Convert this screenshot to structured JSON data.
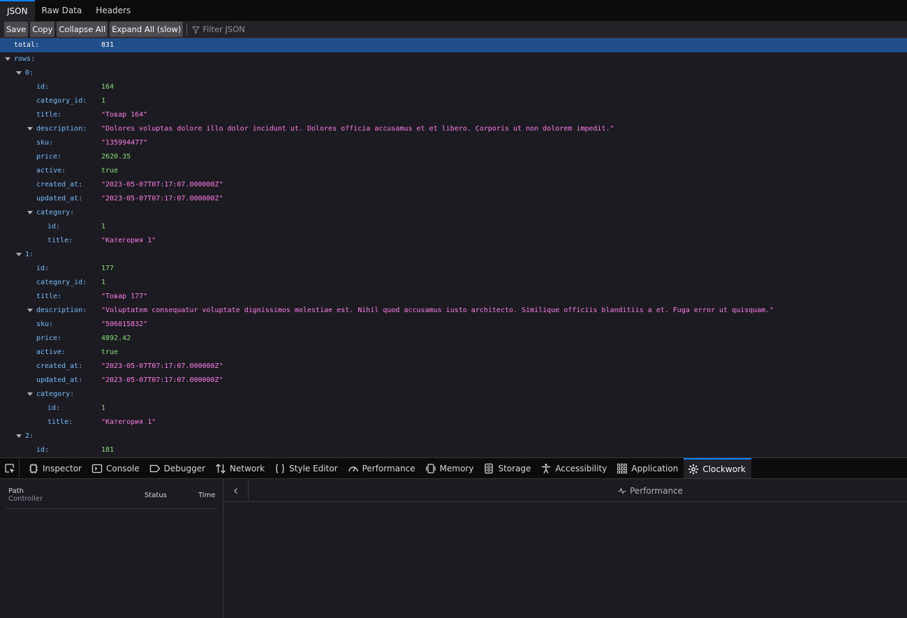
{
  "viewer_tabs": [
    "JSON",
    "Raw Data",
    "Headers"
  ],
  "toolbar": {
    "save_label": "Save",
    "copy_label": "Copy",
    "collapse_label": "Collapse All",
    "expand_label": "Expand All (slow)",
    "filter_placeholder": "Filter JSON"
  },
  "tree": [
    {
      "depth": 0,
      "key": "total:",
      "value": "831",
      "type": "num",
      "selected": true
    },
    {
      "depth": 0,
      "key": "rows:",
      "toggle": true
    },
    {
      "depth": 1,
      "key": "0:",
      "toggle": true
    },
    {
      "depth": 2,
      "key": "id:",
      "value": "164",
      "type": "num"
    },
    {
      "depth": 2,
      "key": "category_id:",
      "value": "1",
      "type": "num"
    },
    {
      "depth": 2,
      "key": "title:",
      "value": "\"Товар 164\"",
      "type": "str"
    },
    {
      "depth": 2,
      "key": "description:",
      "value": "\"Dolores voluptas dolore illo dolor incidunt ut. Dolores officia accusamus et et libero. Corporis ut non dolorem impedit.\"",
      "type": "str",
      "toggle": true
    },
    {
      "depth": 2,
      "key": "sku:",
      "value": "\"135994477\"",
      "type": "str"
    },
    {
      "depth": 2,
      "key": "price:",
      "value": "2620.35",
      "type": "num"
    },
    {
      "depth": 2,
      "key": "active:",
      "value": "true",
      "type": "bool"
    },
    {
      "depth": 2,
      "key": "created_at:",
      "value": "\"2023-05-07T07:17:07.000000Z\"",
      "type": "str"
    },
    {
      "depth": 2,
      "key": "updated_at:",
      "value": "\"2023-05-07T07:17:07.000000Z\"",
      "type": "str"
    },
    {
      "depth": 2,
      "key": "category:",
      "toggle": true
    },
    {
      "depth": 3,
      "key": "id:",
      "value": "1",
      "type": "num"
    },
    {
      "depth": 3,
      "key": "title:",
      "value": "\"Категория 1\"",
      "type": "str"
    },
    {
      "depth": 1,
      "key": "1:",
      "toggle": true
    },
    {
      "depth": 2,
      "key": "id:",
      "value": "177",
      "type": "num"
    },
    {
      "depth": 2,
      "key": "category_id:",
      "value": "1",
      "type": "num"
    },
    {
      "depth": 2,
      "key": "title:",
      "value": "\"Товар 177\"",
      "type": "str"
    },
    {
      "depth": 2,
      "key": "description:",
      "value": "\"Voluptatem consequatur voluptate dignissimos molestiae est. Nihil quod accusamus iusto architecto. Similique officiis blanditiis a et. Fuga error ut quisquam.\"",
      "type": "str",
      "toggle": true
    },
    {
      "depth": 2,
      "key": "sku:",
      "value": "\"506015832\"",
      "type": "str"
    },
    {
      "depth": 2,
      "key": "price:",
      "value": "4892.42",
      "type": "num"
    },
    {
      "depth": 2,
      "key": "active:",
      "value": "true",
      "type": "bool"
    },
    {
      "depth": 2,
      "key": "created_at:",
      "value": "\"2023-05-07T07:17:07.000000Z\"",
      "type": "str"
    },
    {
      "depth": 2,
      "key": "updated_at:",
      "value": "\"2023-05-07T07:17:07.000000Z\"",
      "type": "str"
    },
    {
      "depth": 2,
      "key": "category:",
      "toggle": true
    },
    {
      "depth": 3,
      "key": "id:",
      "value": "1",
      "type": "num"
    },
    {
      "depth": 3,
      "key": "title:",
      "value": "\"Категория 1\"",
      "type": "str"
    },
    {
      "depth": 1,
      "key": "2:",
      "toggle": true
    },
    {
      "depth": 2,
      "key": "id:",
      "value": "181",
      "type": "num"
    }
  ],
  "devtools": {
    "tabs": [
      {
        "label": "Inspector",
        "icon": "inspector-icon"
      },
      {
        "label": "Console",
        "icon": "console-icon"
      },
      {
        "label": "Debugger",
        "icon": "debugger-icon"
      },
      {
        "label": "Network",
        "icon": "network-icon"
      },
      {
        "label": "Style Editor",
        "icon": "style-editor-icon"
      },
      {
        "label": "Performance",
        "icon": "performance-icon"
      },
      {
        "label": "Memory",
        "icon": "memory-icon"
      },
      {
        "label": "Storage",
        "icon": "storage-icon"
      },
      {
        "label": "Accessibility",
        "icon": "accessibility-icon"
      },
      {
        "label": "Application",
        "icon": "application-icon"
      },
      {
        "label": "Clockwork",
        "icon": "gear-icon"
      }
    ],
    "active_tab": "Clockwork"
  },
  "clockwork": {
    "col_path": "Path",
    "col_controller": "Controller",
    "col_status": "Status",
    "col_time": "Time",
    "performance_label": "Performance"
  },
  "colors": {
    "key": "#75bfff",
    "string": "#ff7de9",
    "number": "#86de74",
    "selected_row": "#204e8a",
    "accent": "#0a84ff"
  }
}
